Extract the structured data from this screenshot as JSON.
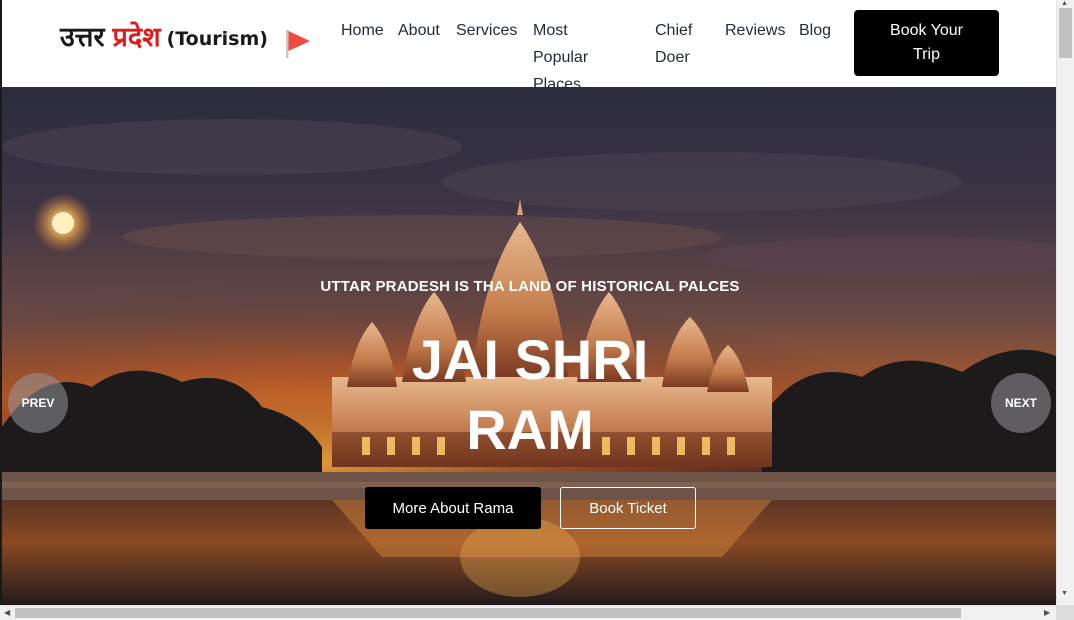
{
  "header": {
    "logo": {
      "hindi_part1": "उत्तर",
      "hindi_part2": "प्रदेश",
      "english": "(Tourism)"
    },
    "nav": [
      {
        "label": "Home"
      },
      {
        "label": "About"
      },
      {
        "label": "Services"
      },
      {
        "label": "Most Popular\nPlaces"
      },
      {
        "label": "Chief\nDoer"
      },
      {
        "label": "Reviews"
      },
      {
        "label": "Blog"
      }
    ],
    "cta_label": "Book Your\nTrip"
  },
  "hero": {
    "subtitle": "UTTAR PRADESH IS THA LAND OF HISTORICAL PALCES",
    "headline": "JAI SHRI\nRAM",
    "primary_button": "More About Rama",
    "secondary_button": "Book Ticket",
    "prev_label": "PREV",
    "next_label": "NEXT"
  },
  "colors": {
    "brand_red": "#e01b1b",
    "flag": "#ef4b3f",
    "button_black": "#000000"
  }
}
